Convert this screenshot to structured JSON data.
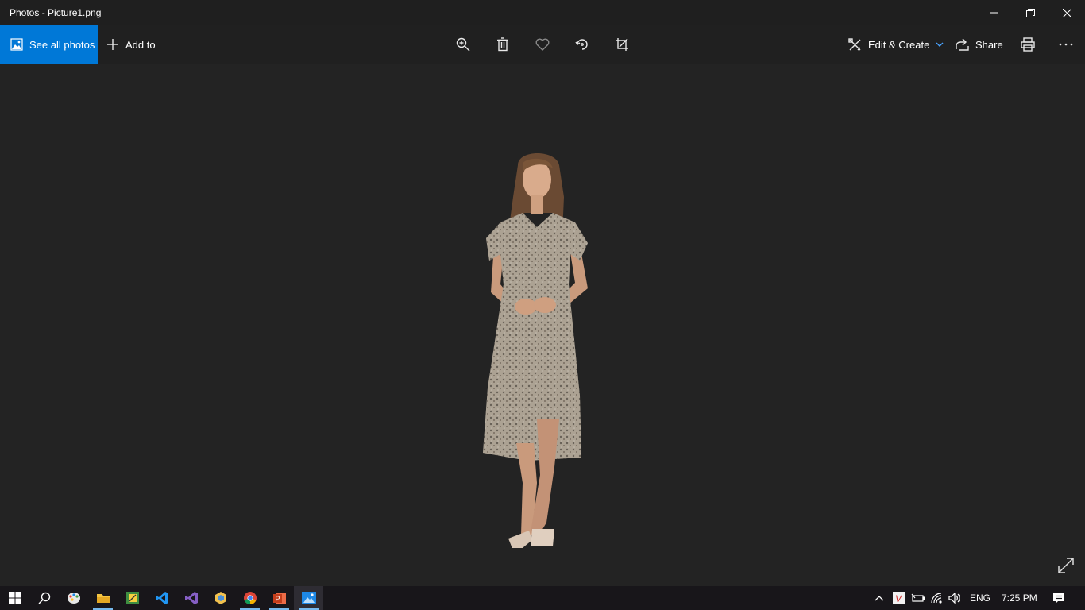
{
  "window": {
    "title": "Photos - Picture1.png"
  },
  "toolbar": {
    "see_all_label": "See all photos",
    "add_to_label": "Add to",
    "edit_create_label": "Edit & Create",
    "share_label": "Share"
  },
  "taskbar": {
    "apps": [
      "start",
      "search",
      "paint",
      "file-explorer",
      "sticky-app",
      "vscode",
      "visual-studio",
      "package-app",
      "chrome",
      "powerpoint",
      "photos"
    ],
    "language": "ENG",
    "time": "7:25 PM"
  },
  "colors": {
    "accent": "#0078d7",
    "background": "#202020",
    "taskbar": "#18161a"
  }
}
